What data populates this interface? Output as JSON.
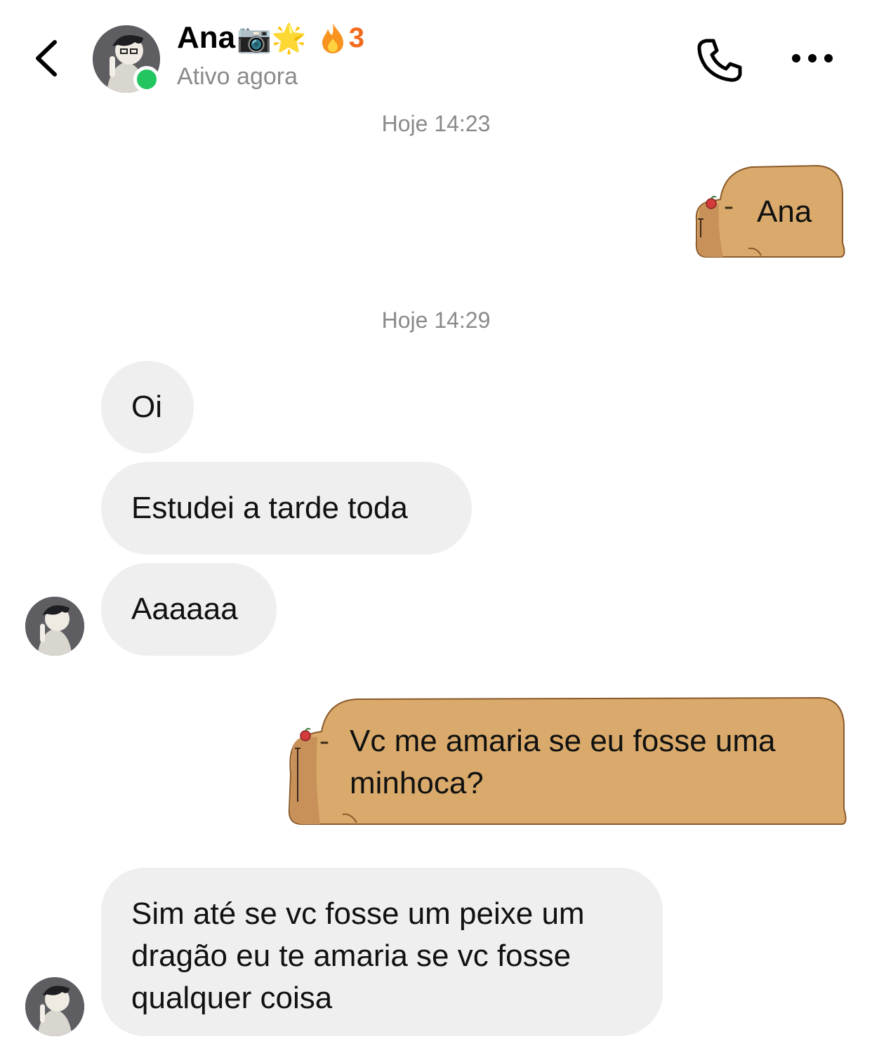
{
  "header": {
    "back_icon": "chevron-left-icon",
    "contact_name": "Ana",
    "name_emojis": "📷🌟",
    "streak_icon": "fire-icon",
    "streak_count": "3",
    "status": "Ativo agora",
    "call_icon": "phone-icon",
    "more_icon": "more-horizontal-icon"
  },
  "messages": {
    "timestamp_1": "Hoje 14:23",
    "sent_1": "Ana",
    "timestamp_2": "Hoje 14:29",
    "recv_1": "Oi",
    "recv_2": "Estudei a tarde toda",
    "recv_3": "Aaaaaa",
    "sent_2_line1": "Vc me amaria se eu fosse uma",
    "sent_2_line2": "minhoca?",
    "recv_4_line1": "Sim até se vc fosse um peixe um",
    "recv_4_line2": "dragão eu te amaria se vc fosse",
    "recv_4_line3": "qualquer coisa"
  },
  "colors": {
    "sticker_fill": "#d9aa6b",
    "sticker_outline": "#8a5a2b",
    "received_bubble": "#efefef",
    "streak": "#f26a1b",
    "online": "#22c55e"
  }
}
